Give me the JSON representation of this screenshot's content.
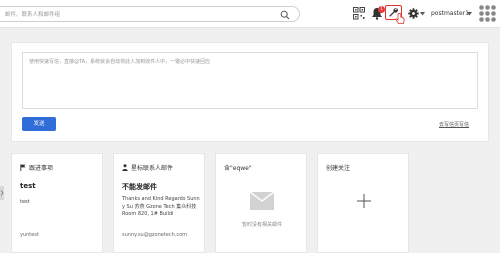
{
  "header": {
    "search": {
      "placeholder": "邮件、联系人和邮件组"
    },
    "badge_count": "1",
    "user": {
      "name": "postmaster1"
    },
    "icons": [
      "search-icon",
      "qr-code-icon",
      "bell-icon",
      "wrench-icon",
      "cursor-hand-icon",
      "gear-icon",
      "chevron-down-icon",
      "avatar-grid-icon"
    ],
    "colors": {
      "badge": "#e23c3c",
      "highlight_border": "#e2332f"
    }
  },
  "compose": {
    "placeholder": "使用快速写信，直接@TA，系统就会自动将此人加到收件人中，一键必中快速回应",
    "send_label": "发送",
    "quick_link": "去写信页写信",
    "colors": {
      "send_button": "#2f6ed8"
    }
  },
  "cards": [
    {
      "header": "跟进事项",
      "icon": "flag-icon",
      "title": "test",
      "lines": [
        "test"
      ],
      "footer": "yuntest"
    },
    {
      "header": "星标联系人邮件",
      "icon": "person-icon",
      "title": "不能发邮件",
      "body": "Thanks and Kind Regards Sunny Su 苏燕 Gzone Tech 集众科技 Room 820, 1# Buildi",
      "footer": "sunny.su@gzonetech.com"
    },
    {
      "header": "含\"eqwe\"",
      "icon": "envelope-icon",
      "empty_text": "暂时没有相关邮件"
    },
    {
      "header": "创建关注",
      "icon": "plus-icon"
    }
  ]
}
